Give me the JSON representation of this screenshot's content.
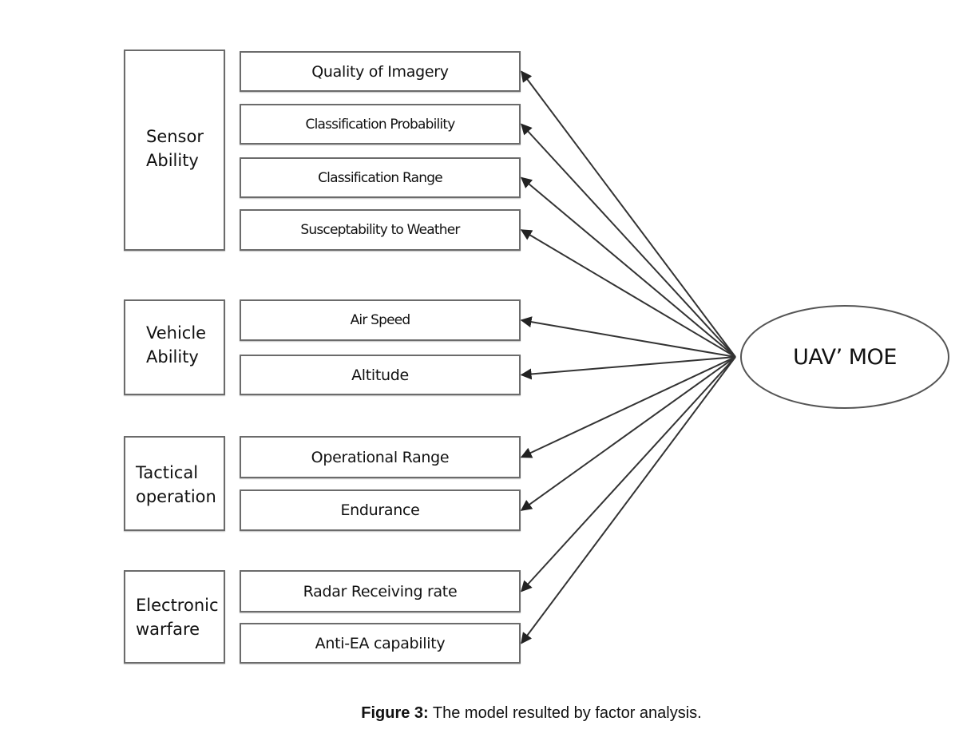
{
  "diagram": {
    "type": "factor-model",
    "central_node": {
      "label": "UAV’ MOE"
    },
    "groups": [
      {
        "label": "Sensor\nAbility",
        "items": [
          {
            "label": "Quality of Imagery"
          },
          {
            "label": "Classification Probability"
          },
          {
            "label": "Classification Range"
          },
          {
            "label": "Susceptability to Weather"
          }
        ]
      },
      {
        "label": "Vehicle\nAbility",
        "items": [
          {
            "label": "Air Speed"
          },
          {
            "label": "Altitude"
          }
        ]
      },
      {
        "label": "Tactical\noperation",
        "items": [
          {
            "label": "Operational Range"
          },
          {
            "label": "Endurance"
          }
        ]
      },
      {
        "label": "Electronic\nwarfare",
        "items": [
          {
            "label": "Radar Receiving rate"
          },
          {
            "label": "Anti-EA capability"
          }
        ]
      }
    ],
    "edges": [
      {
        "from": "UAV’ MOE",
        "to": "Quality of Imagery"
      },
      {
        "from": "UAV’ MOE",
        "to": "Classification Probability"
      },
      {
        "from": "UAV’ MOE",
        "to": "Classification Range"
      },
      {
        "from": "UAV’ MOE",
        "to": "Susceptability to Weather"
      },
      {
        "from": "UAV’ MOE",
        "to": "Air Speed"
      },
      {
        "from": "UAV’ MOE",
        "to": "Altitude"
      },
      {
        "from": "UAV’ MOE",
        "to": "Operational Range"
      },
      {
        "from": "UAV’ MOE",
        "to": "Endurance"
      },
      {
        "from": "UAV’ MOE",
        "to": "Radar Receiving rate"
      },
      {
        "from": "UAV’ MOE",
        "to": "Anti-EA capability"
      }
    ]
  },
  "caption": {
    "prefix": "Figure 3:",
    "text": " The model resulted by factor analysis."
  },
  "colors": {
    "border": "#6b6b6b",
    "arrow": "#333333",
    "text": "#111111"
  }
}
